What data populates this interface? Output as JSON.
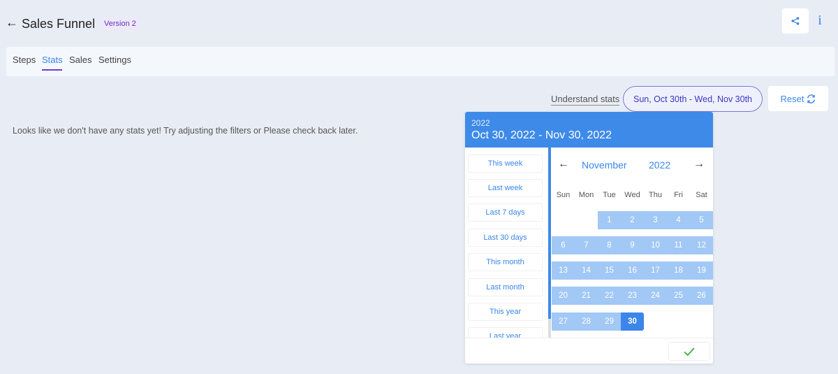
{
  "header": {
    "back": "←",
    "title": "Sales Funnel",
    "version": "Version 2",
    "info": "i"
  },
  "tabs": [
    {
      "label": "Steps"
    },
    {
      "label": "Stats"
    },
    {
      "label": "Sales"
    },
    {
      "label": "Settings"
    }
  ],
  "stats": {
    "understand_label": "Understand stats",
    "range_label": "Sun, Oct 30th - Wed, Nov 30th",
    "reset_label": "Reset",
    "empty_message": "Looks like we don't have any stats yet! Try adjusting the filters or Please check back later."
  },
  "picker": {
    "year": "2022",
    "range": "Oct 30, 2022 - Nov 30, 2022",
    "shortcuts": [
      "This week",
      "Last week",
      "Last 7 days",
      "Last 30 days",
      "This month",
      "Last month",
      "This year",
      "Last year"
    ],
    "prev": "←",
    "next": "→",
    "month": "November",
    "cal_year": "2022",
    "weekdays": [
      "Sun",
      "Mon",
      "Tue",
      "Wed",
      "Thu",
      "Fri",
      "Sat"
    ],
    "days": [
      "1",
      "2",
      "3",
      "4",
      "5",
      "6",
      "7",
      "8",
      "9",
      "10",
      "11",
      "12",
      "13",
      "14",
      "15",
      "16",
      "17",
      "18",
      "19",
      "20",
      "21",
      "22",
      "23",
      "24",
      "25",
      "26",
      "27",
      "28",
      "29",
      "30"
    ]
  },
  "colors": {
    "accent": "#3b86e8",
    "range_fill": "#a2c8f5",
    "confirm": "#4caf50"
  }
}
